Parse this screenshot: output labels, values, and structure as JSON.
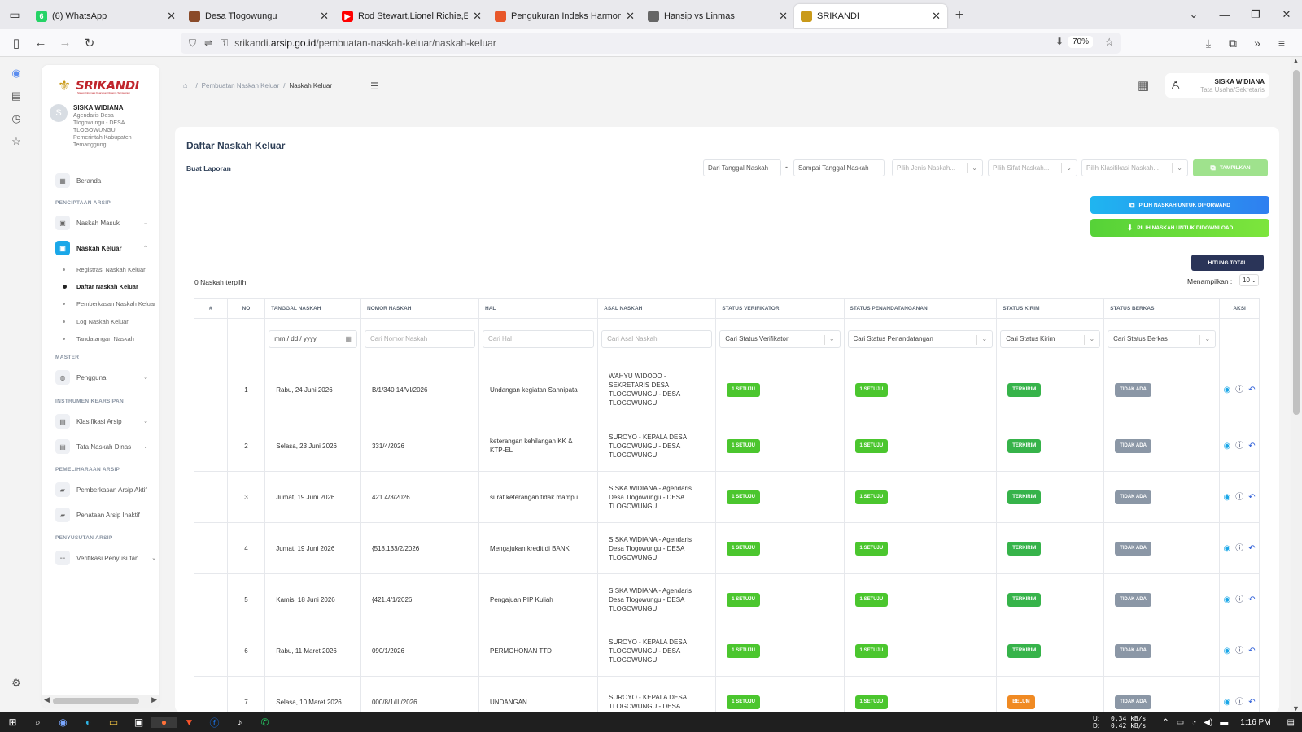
{
  "browser": {
    "tabs": [
      {
        "title": "(6) WhatsApp",
        "fav": "6",
        "color": "#25d366"
      },
      {
        "title": "Desa Tlogowungu",
        "fav": "",
        "color": "#8a4b2a"
      },
      {
        "title": "Rod Stewart,Lionel Richie,El",
        "fav": "▶",
        "color": "#ff0000"
      },
      {
        "title": "Pengukuran Indeks Harmoni Inc",
        "fav": "",
        "color": "#e8572a"
      },
      {
        "title": "Hansip vs Linmas",
        "fav": "",
        "color": "#666666"
      },
      {
        "title": "SRIKANDI",
        "fav": "",
        "color": "#c99a1a"
      }
    ],
    "url_host": "srikandi.arsip.go.id",
    "url_path": "/pembuatan-naskah-keluar/naskah-keluar",
    "url_prefix": "srikandi.",
    "url_host_main": "arsip.go.id",
    "zoom": "70%"
  },
  "app": {
    "logo": "SRIKANDI",
    "logo_sub": "Sistem Informasi Kearsipan Dinamis Terintegrasi",
    "user_name": "SISKA WIDIANA",
    "user_role": "Agendaris Desa Tlogowungu - DESA TLOGOWUNGU Pemerintah Kabupaten Temanggung",
    "avatar_letter": "S"
  },
  "sidebar": {
    "beranda": "Beranda",
    "h_penciptaan": "PENCIPTAAN ARSIP",
    "naskah_masuk": "Naskah Masuk",
    "naskah_keluar": "Naskah Keluar",
    "sub": [
      "Registrasi Naskah Keluar",
      "Daftar Naskah Keluar",
      "Pemberkasan Naskah Keluar",
      "Log Naskah Keluar",
      "Tandatangan Naskah"
    ],
    "h_master": "MASTER",
    "pengguna": "Pengguna",
    "h_instrumen": "INSTRUMEN KEARSIPAN",
    "klasifikasi": "Klasifikasi Arsip",
    "tata_naskah": "Tata Naskah Dinas",
    "h_pemeliharaan": "PEMELIHARAAN ARSIP",
    "pemberkasan_aktif": "Pemberkasan Arsip Aktif",
    "penataan_inaktif": "Penataan Arsip Inaktif",
    "h_penyusutan": "PENYUSUTAN ARSIP",
    "verifikasi": "Verifikasi Penyusutan"
  },
  "header": {
    "crumb1": "Pembuatan Naskah Keluar",
    "crumb2": "Naskah Keluar",
    "profile_name": "SISKA WIDIANA",
    "profile_role": "Tata Usaha/Sekretaris"
  },
  "main": {
    "title": "Daftar Naskah Keluar",
    "buat_laporan": "Buat Laporan",
    "dari_tanggal": "Dari Tanggal Naskah",
    "dash": "-",
    "sampai_tanggal": "Sampai Tanggal Naskah",
    "jenis_ph": "Pilih Jenis Naskah...",
    "sifat_ph": "Pilih Sifat Naskah...",
    "klasifikasi_ph": "Pilih Klasifikasi Naskah...",
    "tampilkan": "TAMPILKAN",
    "forward": "PILIH NASKAH UNTUK DIFORWARD",
    "download": "PILIH NASKAH UNTUK DIDOWNLOAD",
    "hitung": "HITUNG TOTAL",
    "selected": "0 Naskah terpilih",
    "menampilkan": "Menampilkan :",
    "per_page": "10"
  },
  "table": {
    "headers": [
      "#",
      "NO",
      "TANGGAL NASKAH",
      "NOMOR NASKAH",
      "HAL",
      "ASAL NASKAH",
      "STATUS VERIFIKATOR",
      "STATUS PENANDATANGANAN",
      "STATUS KIRIM",
      "STATUS BERKAS",
      "AKSI"
    ],
    "filters": {
      "date": "mm / dd / yyyy",
      "nomor": "Cari Nomor Naskah",
      "hal": "Cari Hal",
      "asal": "Cari Asal Naskah",
      "verifikator": "Cari Status Verifikator",
      "penandatanganan": "Cari Status Penandatangan",
      "kirim": "Cari Status Kirim",
      "berkas": "Cari Status Berkas"
    },
    "rows": [
      {
        "no": "1",
        "tanggal": "Rabu, 24 Juni 2026",
        "nomor": "B/1/340.14/VI/2026",
        "hal": "Undangan kegiatan Sannipata",
        "asal": "WAHYU WIDODO - SEKRETARIS DESA TLOGOWUNGU - DESA TLOGOWUNGU",
        "verif": "1 SETUJU",
        "ttd": "1 SETUJU",
        "kirim": "TERKIRIM",
        "berkas": "TIDAK ADA"
      },
      {
        "no": "2",
        "tanggal": "Selasa, 23 Juni 2026",
        "nomor": "331/4/2026",
        "hal": "keterangan kehilangan KK & KTP-EL",
        "asal": "SUROYO - KEPALA DESA TLOGOWUNGU - DESA TLOGOWUNGU",
        "verif": "1 SETUJU",
        "ttd": "1 SETUJU",
        "kirim": "TERKIRIM",
        "berkas": "TIDAK ADA"
      },
      {
        "no": "3",
        "tanggal": "Jumat, 19 Juni 2026",
        "nomor": "421.4/3/2026",
        "hal": "surat keterangan tidak mampu",
        "asal": "SISKA WIDIANA - Agendaris Desa Tlogowungu - DESA TLOGOWUNGU",
        "verif": "1 SETUJU",
        "ttd": "1 SETUJU",
        "kirim": "TERKIRIM",
        "berkas": "TIDAK ADA"
      },
      {
        "no": "4",
        "tanggal": "Jumat, 19 Juni 2026",
        "nomor": "{518.133/2/2026",
        "hal": "Mengajukan kredit di BANK",
        "asal": "SISKA WIDIANA - Agendaris Desa Tlogowungu - DESA TLOGOWUNGU",
        "verif": "1 SETUJU",
        "ttd": "1 SETUJU",
        "kirim": "TERKIRIM",
        "berkas": "TIDAK ADA"
      },
      {
        "no": "5",
        "tanggal": "Kamis, 18 Juni 2026",
        "nomor": "{421.4/1/2026",
        "hal": "Pengajuan PIP Kuliah",
        "asal": "SISKA WIDIANA - Agendaris Desa Tlogowungu - DESA TLOGOWUNGU",
        "verif": "1 SETUJU",
        "ttd": "1 SETUJU",
        "kirim": "TERKIRIM",
        "berkas": "TIDAK ADA"
      },
      {
        "no": "6",
        "tanggal": "Rabu, 11 Maret 2026",
        "nomor": "090/1/2026",
        "hal": "PERMOHONAN TTD",
        "asal": "SUROYO - KEPALA DESA TLOGOWUNGU - DESA TLOGOWUNGU",
        "verif": "1 SETUJU",
        "ttd": "1 SETUJU",
        "kirim": "TERKIRIM",
        "berkas": "TIDAK ADA"
      },
      {
        "no": "7",
        "tanggal": "Selasa, 10 Maret 2026",
        "nomor": "000/8/1/III/2026",
        "hal": "UNDANGAN",
        "asal": "SUROYO - KEPALA DESA TLOGOWUNGU - DESA",
        "verif": "1 SETUJU",
        "ttd": "1 SETUJU",
        "kirim": "BELUM",
        "berkas": "TIDAK ADA"
      }
    ]
  },
  "taskbar": {
    "net_up": "0.34 kB/s",
    "net_down": "0.42 kB/s",
    "net_up_label": "U:",
    "net_down_label": "D:",
    "time": "1:16 PM"
  }
}
